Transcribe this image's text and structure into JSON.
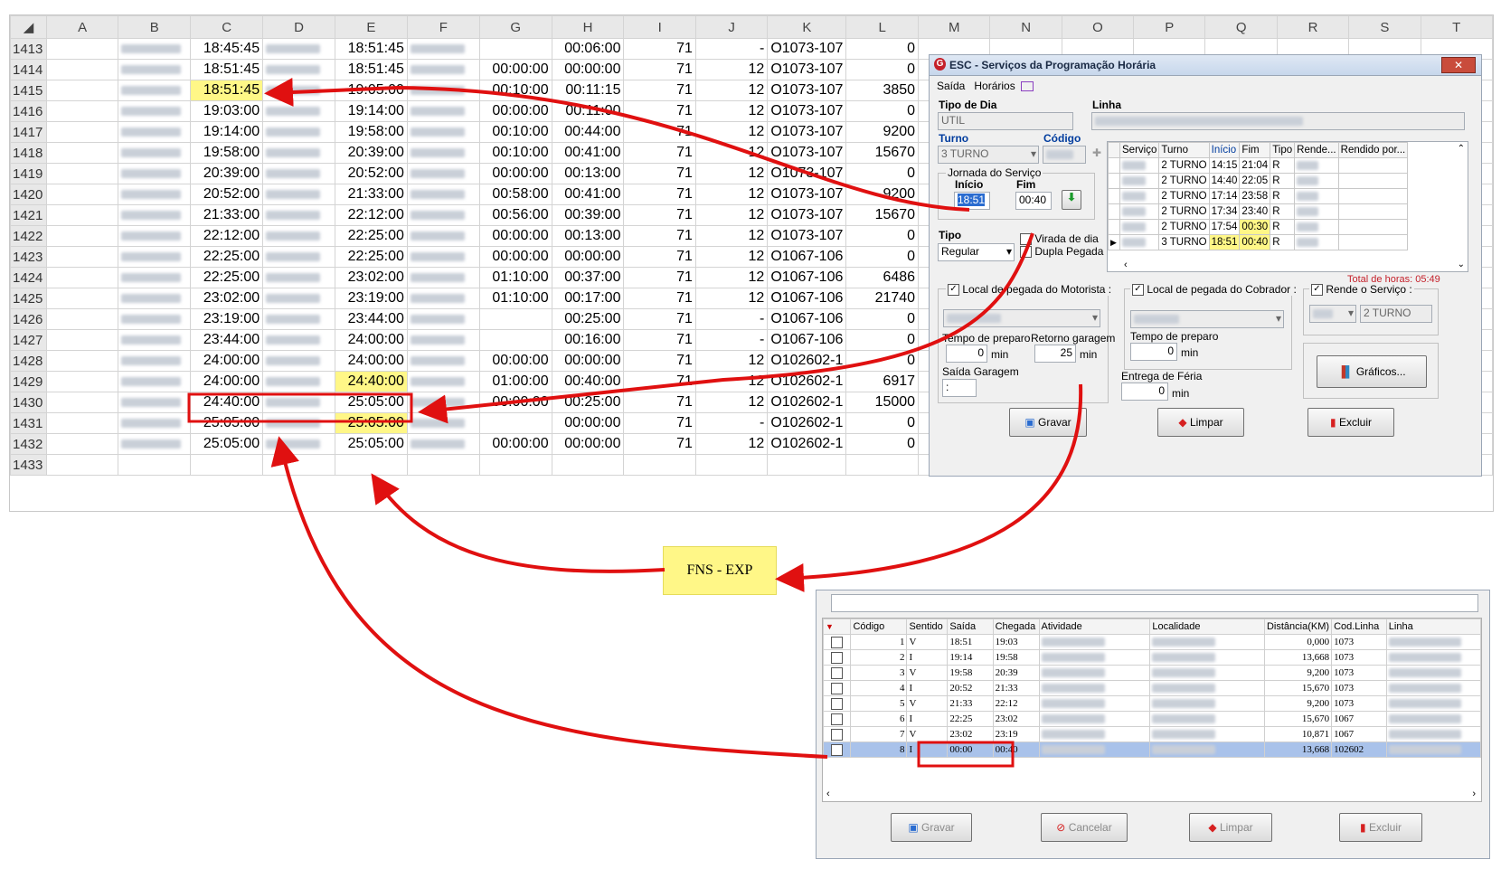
{
  "columns": [
    "A",
    "B",
    "C",
    "D",
    "E",
    "F",
    "G",
    "H",
    "I",
    "J",
    "K",
    "L",
    "M",
    "N",
    "O",
    "P",
    "Q",
    "R",
    "S",
    "T"
  ],
  "rows": [
    {
      "n": "1413",
      "C": "18:45:45",
      "E": "18:51:45",
      "G": "",
      "H": "00:06:00",
      "I": "71",
      "J": "-",
      "K": "O1073-107",
      "L": "0"
    },
    {
      "n": "1414",
      "C": "18:51:45",
      "E": "18:51:45",
      "G": "00:00:00",
      "H": "00:00:00",
      "I": "71",
      "J": "12",
      "K": "O1073-107",
      "L": "0"
    },
    {
      "n": "1415",
      "C": "18:51:45",
      "E": "19:05:00",
      "G": "00:10:00",
      "H": "00:11:15",
      "I": "71",
      "J": "12",
      "K": "O1073-107",
      "L": "3850"
    },
    {
      "n": "1416",
      "C": "19:03:00",
      "E": "19:14:00",
      "G": "00:00:00",
      "H": "00:11:00",
      "I": "71",
      "J": "12",
      "K": "O1073-107",
      "L": "0"
    },
    {
      "n": "1417",
      "C": "19:14:00",
      "E": "19:58:00",
      "G": "00:10:00",
      "H": "00:44:00",
      "I": "71",
      "J": "12",
      "K": "O1073-107",
      "L": "9200"
    },
    {
      "n": "1418",
      "C": "19:58:00",
      "E": "20:39:00",
      "G": "00:10:00",
      "H": "00:41:00",
      "I": "71",
      "J": "12",
      "K": "O1073-107",
      "L": "15670"
    },
    {
      "n": "1419",
      "C": "20:39:00",
      "E": "20:52:00",
      "G": "00:00:00",
      "H": "00:13:00",
      "I": "71",
      "J": "12",
      "K": "O1073-107",
      "L": "0"
    },
    {
      "n": "1420",
      "C": "20:52:00",
      "E": "21:33:00",
      "G": "00:58:00",
      "H": "00:41:00",
      "I": "71",
      "J": "12",
      "K": "O1073-107",
      "L": "9200"
    },
    {
      "n": "1421",
      "C": "21:33:00",
      "E": "22:12:00",
      "G": "00:56:00",
      "H": "00:39:00",
      "I": "71",
      "J": "12",
      "K": "O1073-107",
      "L": "15670"
    },
    {
      "n": "1422",
      "C": "22:12:00",
      "E": "22:25:00",
      "G": "00:00:00",
      "H": "00:13:00",
      "I": "71",
      "J": "12",
      "K": "O1073-107",
      "L": "0"
    },
    {
      "n": "1423",
      "C": "22:25:00",
      "E": "22:25:00",
      "G": "00:00:00",
      "H": "00:00:00",
      "I": "71",
      "J": "12",
      "K": "O1067-106",
      "L": "0"
    },
    {
      "n": "1424",
      "C": "22:25:00",
      "E": "23:02:00",
      "G": "01:10:00",
      "H": "00:37:00",
      "I": "71",
      "J": "12",
      "K": "O1067-106",
      "L": "6486"
    },
    {
      "n": "1425",
      "C": "23:02:00",
      "E": "23:19:00",
      "G": "01:10:00",
      "H": "00:17:00",
      "I": "71",
      "J": "12",
      "K": "O1067-106",
      "L": "21740"
    },
    {
      "n": "1426",
      "C": "23:19:00",
      "E": "23:44:00",
      "G": "",
      "H": "00:25:00",
      "I": "71",
      "J": "-",
      "K": "O1067-106",
      "L": "0"
    },
    {
      "n": "1427",
      "C": "23:44:00",
      "E": "24:00:00",
      "G": "",
      "H": "00:16:00",
      "I": "71",
      "J": "-",
      "K": "O1067-106",
      "L": "0"
    },
    {
      "n": "1428",
      "C": "24:00:00",
      "E": "24:00:00",
      "G": "00:00:00",
      "H": "00:00:00",
      "I": "71",
      "J": "12",
      "K": "O102602-1",
      "L": "0"
    },
    {
      "n": "1429",
      "C": "24:00:00",
      "E": "24:40:00",
      "G": "01:00:00",
      "H": "00:40:00",
      "I": "71",
      "J": "12",
      "K": "O102602-1",
      "L": "6917"
    },
    {
      "n": "1430",
      "C": "24:40:00",
      "E": "25:05:00",
      "G": "00:00:00",
      "H": "00:25:00",
      "I": "71",
      "J": "12",
      "K": "O102602-1",
      "L": "15000"
    },
    {
      "n": "1431",
      "C": "25:05:00",
      "E": "25:05:00",
      "G": "",
      "H": "00:00:00",
      "I": "71",
      "J": "-",
      "K": "O102602-1",
      "L": "0"
    },
    {
      "n": "1432",
      "C": "25:05:00",
      "E": "25:05:00",
      "G": "00:00:00",
      "H": "00:00:00",
      "I": "71",
      "J": "12",
      "K": "O102602-1",
      "L": "0"
    },
    {
      "n": "1433",
      "C": "",
      "E": "",
      "G": "",
      "H": "",
      "I": "",
      "J": "",
      "K": "",
      "L": ""
    }
  ],
  "dialog": {
    "title": "ESC - Serviços da Programação Horária",
    "close": "✕",
    "menu": [
      "Saída",
      "Horários"
    ],
    "tipo_dia_label": "Tipo de Dia",
    "tipo_dia_value": "UTIL",
    "linha_label": "Linha",
    "turno_label": "Turno",
    "turno_value": "3 TURNO",
    "codigo_label": "Código",
    "jornada_label": "Jornada do Serviço",
    "inicio_label": "Início",
    "fim_label": "Fim",
    "inicio_value": "18:51",
    "fim_value": "00:40",
    "tipo_label": "Tipo",
    "tipo_value": "Regular",
    "virada_label": "Virada de dia",
    "dupla_label": "Dupla Pegada",
    "grid_headers": [
      "Serviço",
      "Turno",
      "Início",
      "Fim",
      "Tipo",
      "Rende...",
      "Rendido por..."
    ],
    "grid_rows": [
      {
        "turno": "2 TURNO",
        "inicio": "14:15",
        "fim": "21:04",
        "tipo": "R"
      },
      {
        "turno": "2 TURNO",
        "inicio": "14:40",
        "fim": "22:05",
        "tipo": "R"
      },
      {
        "turno": "2 TURNO",
        "inicio": "17:14",
        "fim": "23:58",
        "tipo": "R"
      },
      {
        "turno": "2 TURNO",
        "inicio": "17:34",
        "fim": "23:40",
        "tipo": "R"
      },
      {
        "turno": "2 TURNO",
        "inicio": "17:54",
        "fim": "00:30",
        "tipo": "R"
      },
      {
        "turno": "3 TURNO",
        "inicio": "18:51",
        "fim": "00:40",
        "tipo": "R"
      }
    ],
    "total_horas": "Total de horas: 05:49",
    "local_motorista": "Local de pegada do Motorista :",
    "local_cobrador": "Local de pegada do Cobrador :",
    "rende_servico": "Rende o Serviço :",
    "rende_value": "2 TURNO",
    "tempo_preparo": "Tempo de preparo",
    "tempo_preparo_value": "0",
    "retorno_garagem": "Retorno garagem",
    "retorno_value": "25",
    "min": "min",
    "saida_garagem": "Saída Garagem",
    "saida_garagem_value": ":",
    "tempo_preparo2_value": "0",
    "entrega_feria": "Entrega de Féria",
    "entrega_value": "0",
    "graficos": "Gráficos...",
    "gravar": "Gravar",
    "limpar": "Limpar",
    "excluir": "Excluir"
  },
  "note": "FNS - EXP",
  "list": {
    "headers": [
      "Código",
      "Sentido",
      "Saída",
      "Chegada",
      "Atividade",
      "Localidade",
      "Distância(KM)",
      "Cod.Linha",
      "Linha"
    ],
    "rows": [
      {
        "codigo": "1",
        "sentido": "V",
        "saida": "18:51",
        "chegada": "19:03",
        "dist": "0,000",
        "cod": "1073"
      },
      {
        "codigo": "2",
        "sentido": "I",
        "saida": "19:14",
        "chegada": "19:58",
        "dist": "13,668",
        "cod": "1073"
      },
      {
        "codigo": "3",
        "sentido": "V",
        "saida": "19:58",
        "chegada": "20:39",
        "dist": "9,200",
        "cod": "1073"
      },
      {
        "codigo": "4",
        "sentido": "I",
        "saida": "20:52",
        "chegada": "21:33",
        "dist": "15,670",
        "cod": "1073"
      },
      {
        "codigo": "5",
        "sentido": "V",
        "saida": "21:33",
        "chegada": "22:12",
        "dist": "9,200",
        "cod": "1073"
      },
      {
        "codigo": "6",
        "sentido": "I",
        "saida": "22:25",
        "chegada": "23:02",
        "dist": "15,670",
        "cod": "1067"
      },
      {
        "codigo": "7",
        "sentido": "V",
        "saida": "23:02",
        "chegada": "23:19",
        "dist": "10,871",
        "cod": "1067"
      },
      {
        "codigo": "8",
        "sentido": "I",
        "saida": "00:00",
        "chegada": "00:40",
        "dist": "13,668",
        "cod": "102602"
      }
    ],
    "gravar": "Gravar",
    "cancelar": "Cancelar",
    "limpar": "Limpar",
    "excluir": "Excluir"
  },
  "colors": {
    "highlight": "#fff787",
    "arrow": "#e01010",
    "selected_row": "#a9c2ea"
  }
}
